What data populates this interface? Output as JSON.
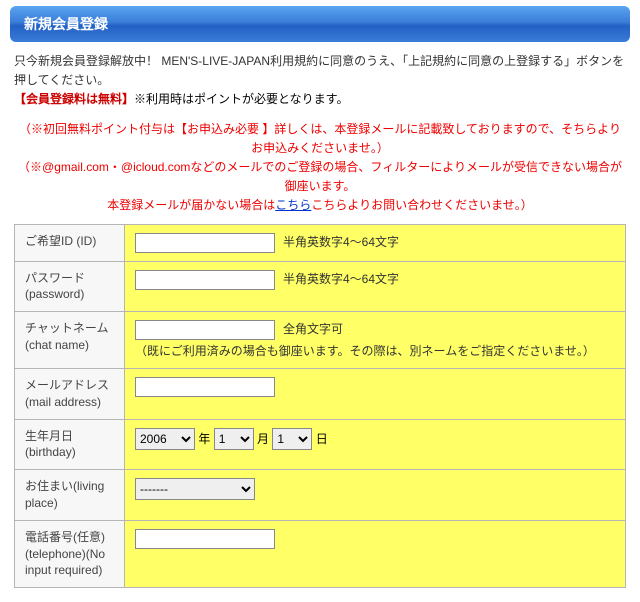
{
  "header": {
    "title": "新規会員登録"
  },
  "intro": {
    "line1_prefix": "只今新規会員登録解放中！ MEN'S-LIVE-JAPAN利用規約に同意のうえ、「上記規約に同意の上登録する」ボタンを押してください。",
    "free_label": "【会員登録料は無料】",
    "line2_suffix": "※利用時はポイントが必要となります。"
  },
  "notice": {
    "l1": "（※初回無料ポイント付与は【お申込み必要 】詳しくは、本登録メールに記載致しておりますので、そちらよりお申込みくださいませ。）",
    "l2": "（※@gmail.com・@icloud.comなどのメールでのご登録の場合、フィルターによりメールが受信できない場合が御座います。",
    "l3_pre": "本登録メールが届かない場合は",
    "l3_link": "こちら",
    "l3_post": "こちらよりお問い合わせくださいませ。）"
  },
  "form": {
    "id": {
      "label": "ご希望ID (ID)",
      "value": "",
      "hint": "半角英数字4～64文字"
    },
    "password": {
      "label": "パスワード(password)",
      "value": "",
      "hint": "半角英数字4～64文字"
    },
    "chatname": {
      "label": "チャットネーム (chat name)",
      "value": "",
      "hint1": "全角文字可",
      "hint2": "（既にご利用済みの場合も御座います。その際は、別ネームをご指定くださいませ。）"
    },
    "mail": {
      "label": "メールアドレス (mail address)",
      "value": ""
    },
    "birthday": {
      "label": "生年月日(birthday)",
      "year": "2006",
      "month": "1",
      "day": "1",
      "year_suffix": "年",
      "month_suffix": "月",
      "day_suffix": "日"
    },
    "living": {
      "label": "お住まい(living place)",
      "selected": "-------"
    },
    "telephone": {
      "label": "電話番号(任意)(telephone)(No input required)",
      "value": ""
    }
  }
}
